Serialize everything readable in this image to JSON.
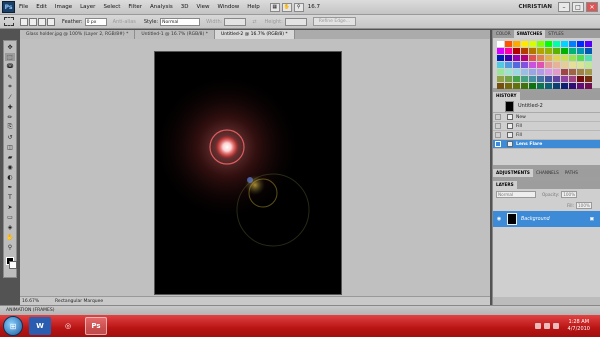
{
  "menubar": {
    "app_logo": "Ps",
    "items": [
      "File",
      "Edit",
      "Image",
      "Layer",
      "Select",
      "Filter",
      "Analysis",
      "3D",
      "View",
      "Window",
      "Help"
    ],
    "zoom_value": "16.7",
    "user": "CHRISTIAN",
    "window_controls": [
      "–",
      "□",
      "✕"
    ]
  },
  "options": {
    "feather_label": "Feather:",
    "feather_value": "0 px",
    "antialias_label": "Anti-alias",
    "style_label": "Style:",
    "style_value": "Normal",
    "width_label": "Width:",
    "height_label": "Height:",
    "refine_label": "Refine Edge..."
  },
  "tabs": [
    {
      "label": "Glass holder.jpg @ 100% (Layer 2, RGB/8#) *",
      "active": false
    },
    {
      "label": "Untitled-1 @ 16.7% (RGB/8) *",
      "active": false
    },
    {
      "label": "Untitled-2 @ 16.7% (RGB/8) *",
      "active": true
    }
  ],
  "toolbox": {
    "tools": [
      "move-tool",
      "marquee-tool",
      "lasso-tool",
      "quick-select-tool",
      "crop-tool",
      "eyedropper-tool",
      "healing-tool",
      "brush-tool",
      "clone-tool",
      "history-brush-tool",
      "eraser-tool",
      "gradient-tool",
      "blur-tool",
      "dodge-tool",
      "pen-tool",
      "type-tool",
      "path-select-tool",
      "shape-tool",
      "3d-tool",
      "hand-tool",
      "zoom-tool"
    ],
    "glyphs": [
      "✥",
      "⬚",
      "ↈ",
      "✎",
      "⌗",
      "⁄",
      "✚",
      "✏",
      "⎘",
      "↺",
      "◫",
      "▰",
      "◉",
      "◐",
      "✒",
      "T",
      "➤",
      "▭",
      "◈",
      "✋",
      "⚲"
    ]
  },
  "status": {
    "zoom": "16.67%",
    "tool_info": "Rectangular Marquee"
  },
  "animation_panel_label": "ANIMATION (FRAMES)",
  "panels": {
    "color_tabs": [
      {
        "label": "COLOR",
        "active": false
      },
      {
        "label": "SWATCHES",
        "active": true
      },
      {
        "label": "STYLES",
        "active": false
      }
    ],
    "history_tab": "HISTORY",
    "history_snapshot": "Untitled-2",
    "history_items": [
      {
        "label": "New",
        "selected": false
      },
      {
        "label": "Fill",
        "selected": false
      },
      {
        "label": "Fill",
        "selected": false
      },
      {
        "label": "Lens Flare",
        "selected": true
      }
    ],
    "adjust_tabs": [
      {
        "label": "ADJUSTMENTS",
        "active": true
      },
      {
        "label": "CHANNELS",
        "active": false
      },
      {
        "label": "PATHS",
        "active": false
      }
    ],
    "layers_tab": "LAYERS",
    "blend_mode": "Normal",
    "opacity_label": "Opacity:",
    "opacity_value": "100%",
    "fill_label": "Fill:",
    "fill_value": "100%",
    "layer_name": "Background"
  },
  "taskbar": {
    "apps": [
      "W",
      "◎",
      "Ps"
    ],
    "time": "1:28 AM",
    "date": "4/7/2010"
  },
  "colors": {
    "selection_blue": "#3d8bd6",
    "taskbar_red": "#c41a1a",
    "canvas_bg": "#000000",
    "workspace_gray": "#c0c0c0"
  }
}
